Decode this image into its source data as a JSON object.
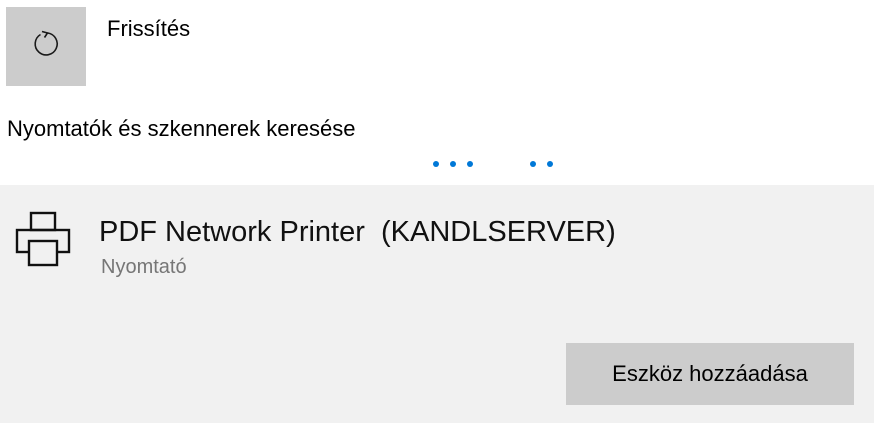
{
  "refresh": {
    "label": "Frissítés",
    "icon": "refresh-icon"
  },
  "search": {
    "status_text": "Nyomtatók és szkennerek keresése",
    "indicator": "progress-dots",
    "accent_color": "#0078d7"
  },
  "device": {
    "name": "PDF Network Printer  (KANDLSERVER)",
    "type": "Nyomtató",
    "icon": "printer-icon",
    "add_button_label": "Eszköz hozzáadása"
  }
}
